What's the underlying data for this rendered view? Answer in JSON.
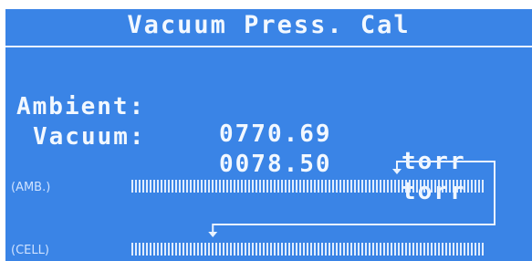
{
  "title": "Vacuum Press. Cal",
  "readings": [
    {
      "label": "Ambient:",
      "value": "0770.69",
      "unit": "torr"
    },
    {
      "label": "Vacuum:",
      "value": "0078.50",
      "unit": "torr"
    }
  ],
  "scales": [
    {
      "label": "(AMB.)",
      "marker_level": 0.75
    },
    {
      "label": "(CELL)",
      "marker_level": 0.23
    }
  ],
  "colors": {
    "screen": "#3a84e6",
    "text": "#f2f8ff"
  }
}
